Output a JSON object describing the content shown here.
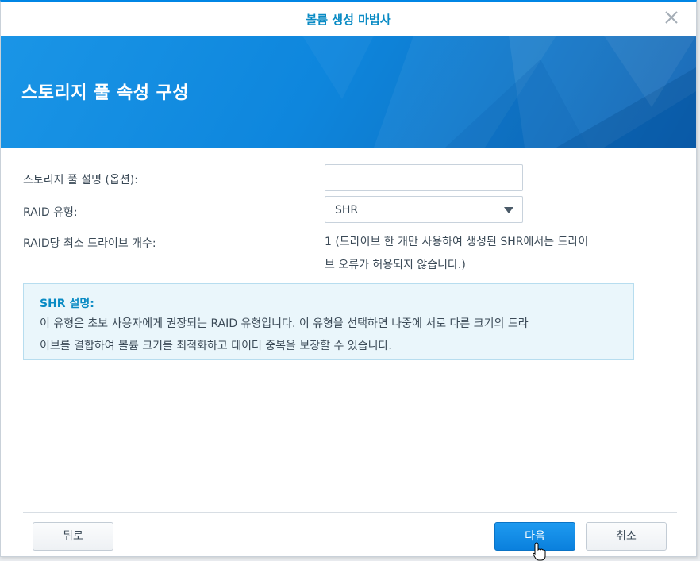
{
  "window": {
    "title": "볼륨 생성 마법사",
    "close_icon": "close-icon"
  },
  "banner": {
    "title": "스토리지 풀 속성 구성"
  },
  "form": {
    "description_label": "스토리지 풀 설명 (옵션):",
    "description_value": "",
    "raid_type_label": "RAID 유형:",
    "raid_type_value": "SHR",
    "min_drives_label": "RAID당 최소 드라이브 개수:",
    "min_drives_value_line1": "1 (드라이브 한 개만 사용하여 생성된 SHR에서는 드라이",
    "min_drives_value_line2": "브 오류가 허용되지 않습니다.)"
  },
  "info": {
    "title": "SHR 설명:",
    "body_line1": "이 유형은 초보 사용자에게 권장되는 RAID 유형입니다. 이 유형을 선택하면 나중에 서로 다른 크기의 드라",
    "body_line2": "이브를 결합하여 볼륨 크기를 최적화하고 데이터 중복을 보장할 수 있습니다."
  },
  "footer": {
    "back_label": "뒤로",
    "next_label": "다음",
    "cancel_label": "취소"
  },
  "colors": {
    "accent": "#0a8bc4",
    "primary_button": "#0a80dd",
    "banner": "#0e86dd",
    "info_background": "#eaf6fb"
  }
}
